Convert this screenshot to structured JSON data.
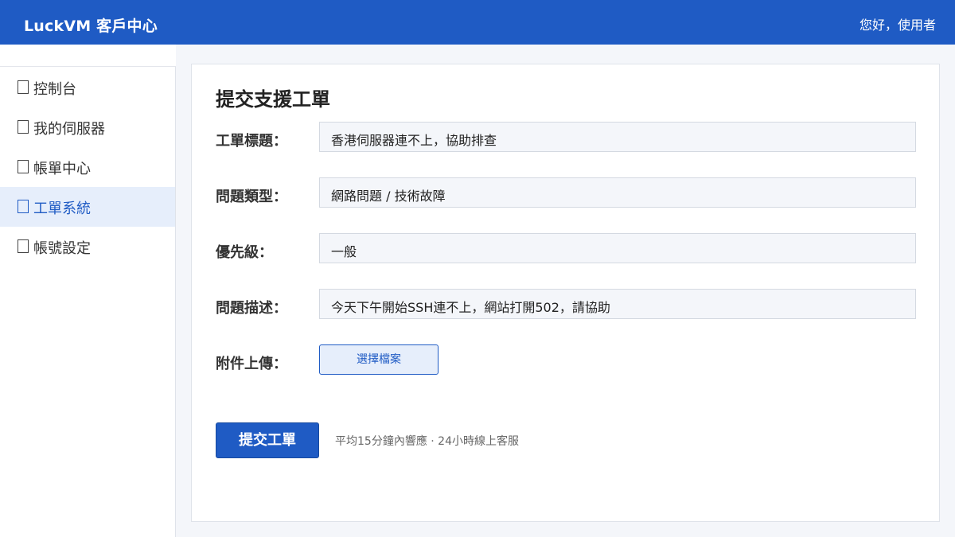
{
  "header": {
    "brand": "LuckVM 客戶中心",
    "greeting": "您好，使用者"
  },
  "sidebar": {
    "items": [
      {
        "label": "控制台",
        "icon": "placeholder-box-icon",
        "active": false
      },
      {
        "label": "我的伺服器",
        "icon": "placeholder-box-icon",
        "active": false
      },
      {
        "label": "帳單中心",
        "icon": "placeholder-box-icon",
        "active": false
      },
      {
        "label": "工單系統",
        "icon": "placeholder-box-icon",
        "active": true
      },
      {
        "label": "帳號設定",
        "icon": "placeholder-box-icon",
        "active": false
      }
    ]
  },
  "form": {
    "title": "提交支援工單",
    "fields": [
      {
        "label": "工單標題：",
        "value": "香港伺服器連不上，協助排查"
      },
      {
        "label": "問題類型：",
        "value": "網路問題 / 技術故障"
      },
      {
        "label": "優先級：",
        "value": "一般"
      },
      {
        "label": "問題描述：",
        "value": "今天下午開始SSH連不上，網站打開502，請協助"
      }
    ],
    "attachment": {
      "label": "附件上傳：",
      "button": "選擇檔案"
    },
    "submit": "提交工單",
    "note": "平均15分鐘內響應 · 24小時線上客服"
  },
  "colors": {
    "primary": "#1f5bc4",
    "active_bg": "#e6eefb",
    "page_bg": "#f4f6fa"
  }
}
